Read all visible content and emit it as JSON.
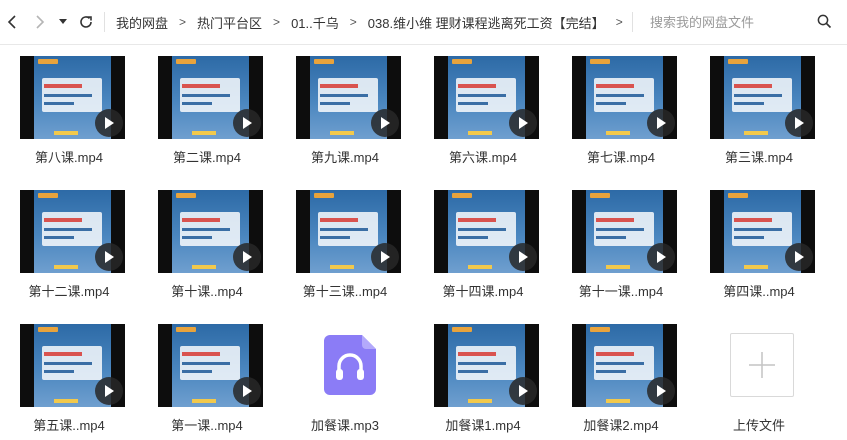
{
  "nav": {
    "back_icon": "chevron-left-icon",
    "forward_icon": "chevron-right-icon",
    "history_icon": "caret-down-icon",
    "refresh_icon": "refresh-icon"
  },
  "breadcrumb": {
    "items": [
      "我的网盘",
      "热门平台区",
      "01..千乌",
      "038.维小维 理财课程逃离死工资【完结】"
    ],
    "separator": ">"
  },
  "search": {
    "placeholder": "搜索我的网盘文件",
    "icon": "search-icon"
  },
  "files": [
    {
      "name": "第八课.mp4",
      "type": "video"
    },
    {
      "name": "第二课.mp4",
      "type": "video"
    },
    {
      "name": "第九课.mp4",
      "type": "video"
    },
    {
      "name": "第六课.mp4",
      "type": "video"
    },
    {
      "name": "第七课.mp4",
      "type": "video"
    },
    {
      "name": "第三课.mp4",
      "type": "video"
    },
    {
      "name": "第十二课.mp4",
      "type": "video"
    },
    {
      "name": "第十课..mp4",
      "type": "video"
    },
    {
      "name": "第十三课..mp4",
      "type": "video"
    },
    {
      "name": "第十四课.mp4",
      "type": "video"
    },
    {
      "name": "第十一课..mp4",
      "type": "video"
    },
    {
      "name": "第四课..mp4",
      "type": "video"
    },
    {
      "name": "第五课..mp4",
      "type": "video"
    },
    {
      "name": "第一课..mp4",
      "type": "video"
    },
    {
      "name": "加餐课.mp3",
      "type": "audio"
    },
    {
      "name": "加餐课1.mp4",
      "type": "video"
    },
    {
      "name": "加餐课2.mp4",
      "type": "video"
    },
    {
      "name": "上传文件",
      "type": "upload"
    }
  ],
  "colors": {
    "audio_icon": "#8b7cf6",
    "thumb_background": "#2d6aa6",
    "play_button": "#282828"
  }
}
